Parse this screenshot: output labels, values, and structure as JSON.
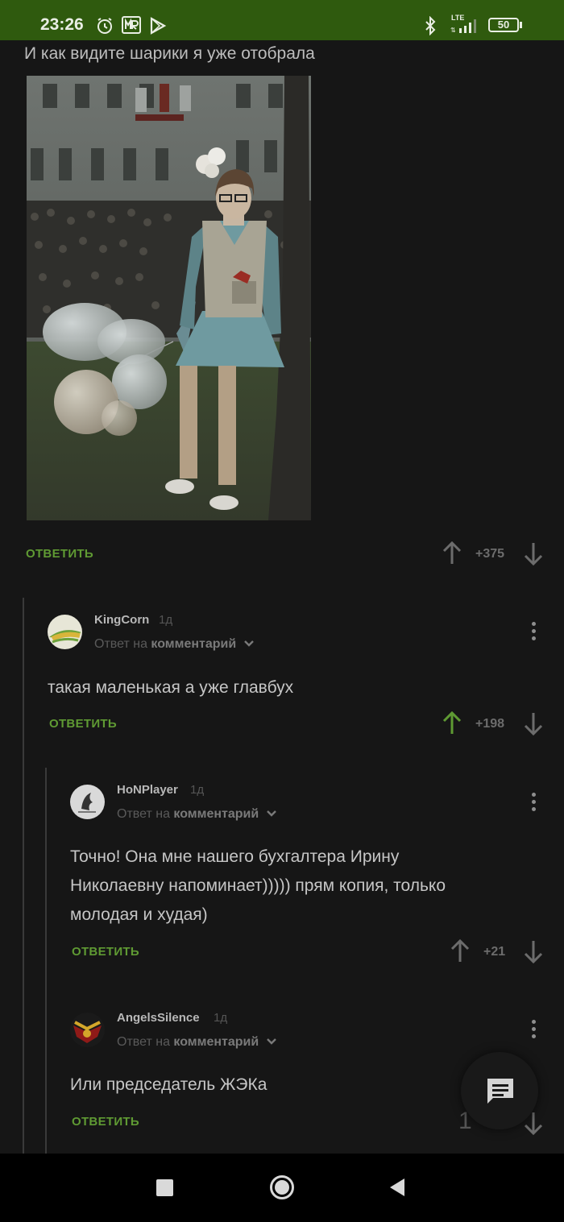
{
  "status_bar": {
    "time": "23:26",
    "network": "LTE",
    "battery": "50"
  },
  "post": {
    "text": "И как видите шарики я уже отобрала",
    "reply_label": "ОТВЕТИТЬ",
    "score": "+375"
  },
  "comments": [
    {
      "author": "KingCorn",
      "age": "1д",
      "reply_prefix": "Ответ на",
      "reply_target": "комментарий",
      "text": "такая маленькая а уже главбух",
      "reply_label": "ОТВЕТИТЬ",
      "score": "+198"
    },
    {
      "author": "HoNPlayer",
      "age": "1д",
      "reply_prefix": "Ответ на",
      "reply_target": "комментарий",
      "text_lines": [
        "Точно! Она мне нашего бухгалтера Ирину",
        "Николаевну напоминает))))) прям копия, только",
        "молодая и худая)"
      ],
      "reply_label": "ОТВЕТИТЬ",
      "score": "+21"
    },
    {
      "author": "AngelsSilence",
      "age": "1д",
      "reply_prefix": "Ответ на",
      "reply_target": "комментарий",
      "text": "Или председатель ЖЭКа",
      "reply_label": "ОТВЕТИТЬ",
      "score": "1"
    }
  ],
  "colors": {
    "statusbar": "#2f5a0e",
    "accent_green": "#5f9a33",
    "upvoted": "#5f9a33",
    "background": "#161616"
  },
  "icons": [
    "alarm-icon",
    "mr-app-icon",
    "play-store-icon",
    "bluetooth-icon",
    "signal-icon",
    "battery-icon",
    "upvote-arrow-icon",
    "downvote-arrow-icon",
    "more-vertical-icon",
    "chevron-down-icon",
    "comment-icon",
    "nav-recents-icon",
    "nav-home-icon",
    "nav-back-icon"
  ]
}
